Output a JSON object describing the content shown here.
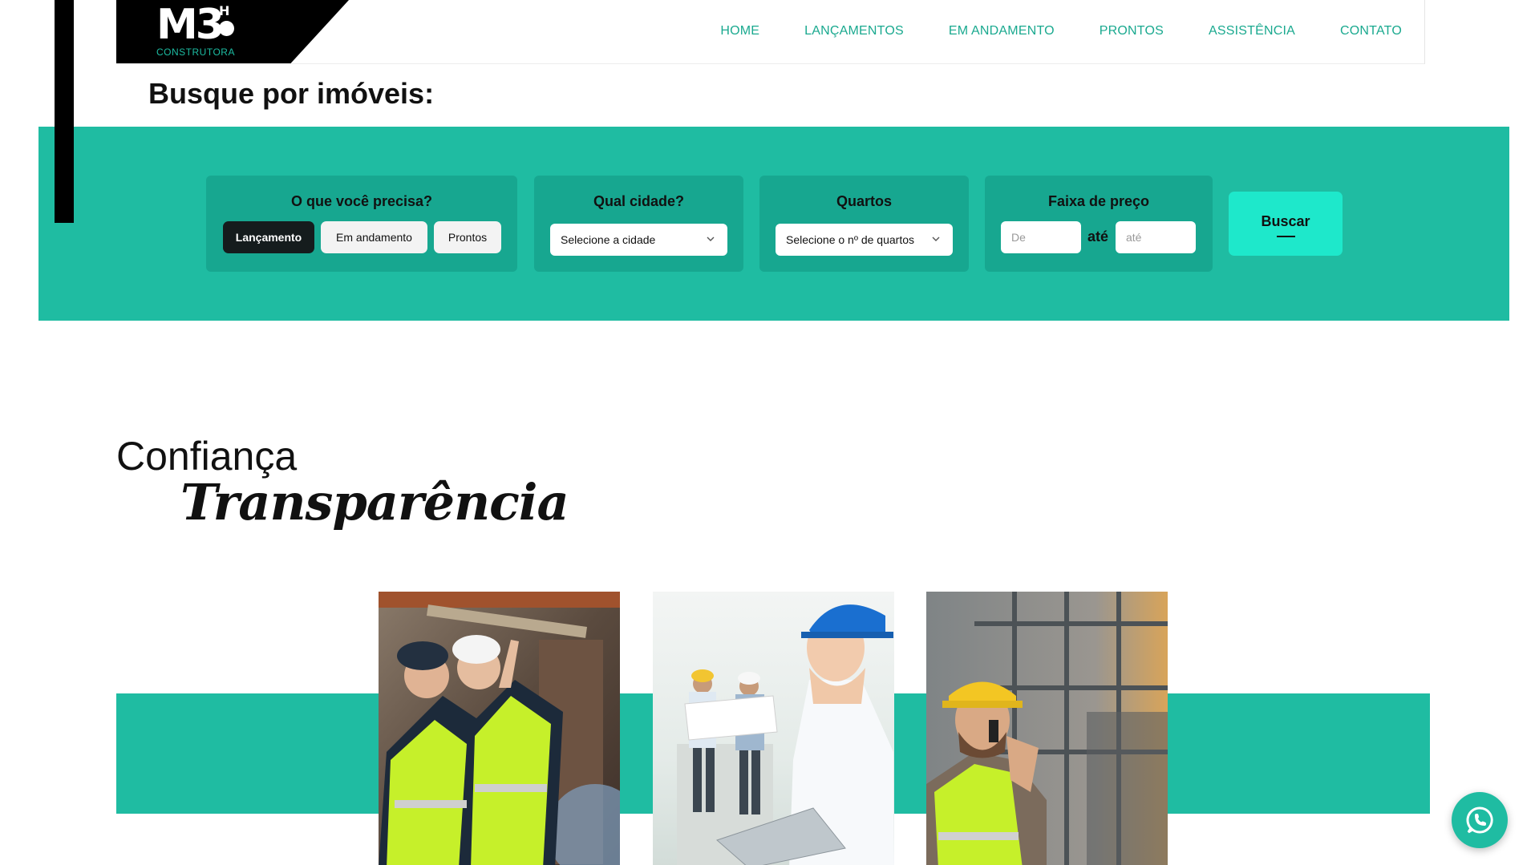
{
  "brand": {
    "logo_text": "M3",
    "logo_h": "H",
    "logo_sub": "CONSTRUTORA",
    "accent": "#1fbca2",
    "accent_dark": "#17a790",
    "button_accent": "#1ee8cb"
  },
  "nav": {
    "items": [
      {
        "label": "HOME"
      },
      {
        "label": "LANÇAMENTOS"
      },
      {
        "label": "EM ANDAMENTO"
      },
      {
        "label": "PRONTOS"
      },
      {
        "label": "ASSISTÊNCIA"
      },
      {
        "label": "CONTATO"
      }
    ]
  },
  "search": {
    "title": "Busque por imóveis:",
    "need": {
      "title": "O que você precisa?",
      "options": [
        "Lançamento",
        "Em andamento",
        "Prontos"
      ],
      "selected": "Lançamento"
    },
    "city": {
      "title": "Qual cidade?",
      "value": "Selecione a cidade"
    },
    "rooms": {
      "title": "Quartos",
      "value": "Selecione o nº de quartos"
    },
    "price": {
      "title": "Faixa de preço",
      "from_placeholder": "De",
      "separator": "até",
      "to_placeholder": "até"
    },
    "button_label": "Buscar"
  },
  "confianca": {
    "line1": "Confiança",
    "line2": "Transparência"
  },
  "icons": {
    "chevron": "chevron-down-icon",
    "whatsapp": "whatsapp-icon"
  }
}
